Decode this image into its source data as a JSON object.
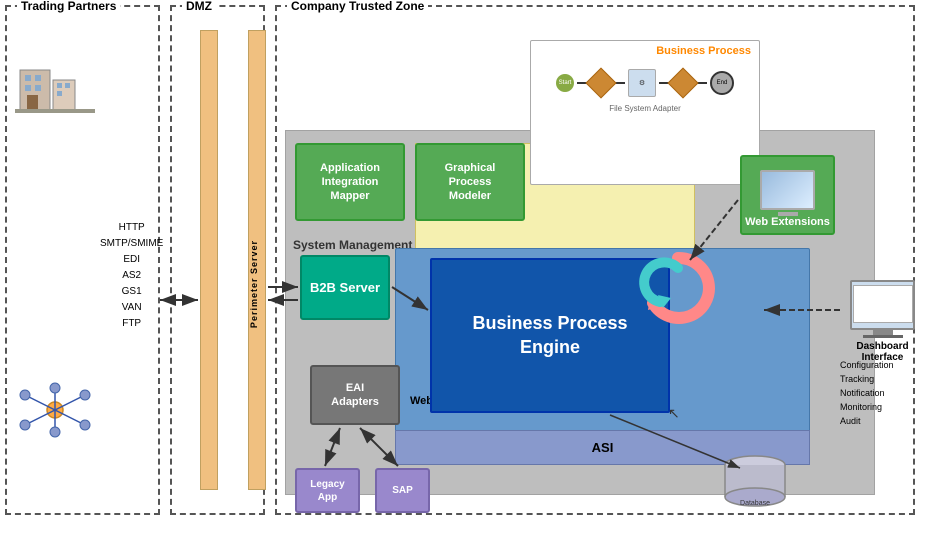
{
  "zones": {
    "trading_partners": "Trading Partners",
    "dmz": "DMZ",
    "trusted": "Company Trusted Zone"
  },
  "perimeter": {
    "label": "Perimeter Server"
  },
  "protocols": {
    "items": [
      "HTTP",
      "SMTP/SMIME",
      "EDI",
      "AS2",
      "GS1",
      "VAN",
      "FTP"
    ]
  },
  "b2b": {
    "label": "B2B Server"
  },
  "sys_mgmt": {
    "label": "System Management"
  },
  "aim": {
    "line1": "Application",
    "line2": "Integration",
    "line3": "Mapper"
  },
  "gpm": {
    "line1": "Graphical",
    "line2": "Process",
    "line3": "Modeler"
  },
  "bpe": {
    "line1": "Business Process",
    "line2": "Engine"
  },
  "web_extensions": {
    "label": "Web Extensions"
  },
  "web_container": {
    "label": "Web Container"
  },
  "asi": {
    "label": "ASI"
  },
  "eai": {
    "line1": "EAI",
    "line2": "Adapters"
  },
  "legacy": {
    "line1": "Legacy",
    "line2": "App"
  },
  "sap": {
    "label": "SAP"
  },
  "business_process": {
    "label": "Business Process",
    "sublabel": "File System Adapter"
  },
  "dashboard": {
    "label": "Dashboard Interface"
  },
  "config_labels": {
    "items": [
      "Configuration",
      "Tracking",
      "Notification",
      "Monitoring",
      "Audit"
    ]
  },
  "database": {
    "label": "Database"
  }
}
